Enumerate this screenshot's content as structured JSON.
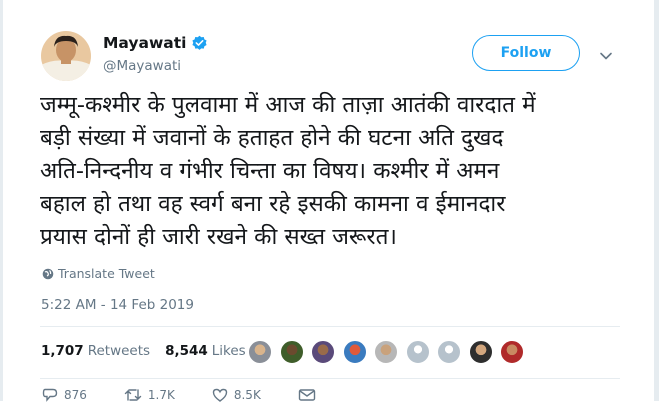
{
  "author": {
    "name": "Mayawati",
    "handle": "@Mayawati",
    "verified": true
  },
  "follow_button": {
    "label": "Follow",
    "color": "#1da1f2"
  },
  "menu": {
    "icon": "chevron-down-icon"
  },
  "tweet": {
    "lines": [
      "जम्मू-कश्मीर के पुलवामा में आज की ताज़ा आतंकी वारदात में",
      "बड़ी संख्या में जवानों के हताहत होने की घटना अति दुखद",
      "अति-निन्दनीय व गंभीर चिन्ता का विषय। कश्मीर में अमन",
      "बहाल हो तथा वह स्वर्ग बना रहे इसकी कामना व ईमानदार",
      "प्रयास दोनों ही जारी रखने की सख्त जरूरत।"
    ],
    "translate_label": "Translate Tweet",
    "timestamp": "5:22 AM - 14 Feb 2019"
  },
  "stats": {
    "retweets_count": "1,707",
    "retweets_label": "Retweets",
    "likes_count": "8,544",
    "likes_label": "Likes"
  },
  "actions": {
    "replies": "876",
    "retweets": "1.7K",
    "likes": "8.5K"
  },
  "colors": {
    "text": "#14171a",
    "muted": "#657786",
    "accent": "#1da1f2",
    "divider": "#e6ecf0"
  }
}
